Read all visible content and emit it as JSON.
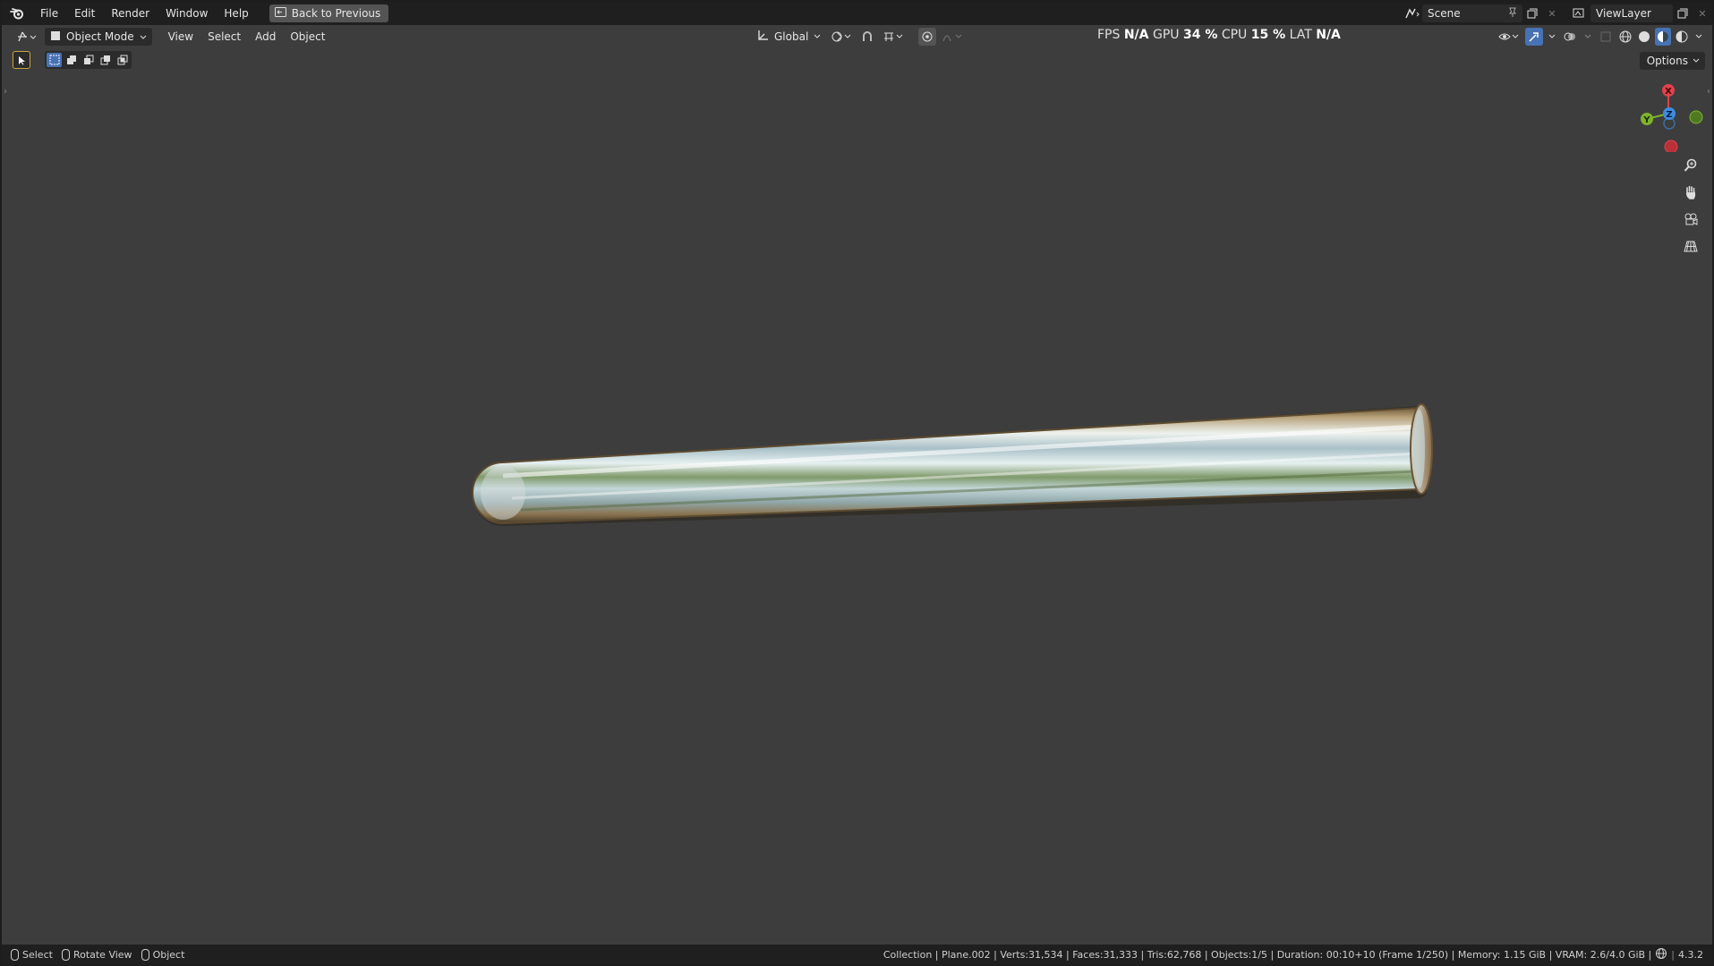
{
  "topbar": {
    "menus": [
      "File",
      "Edit",
      "Render",
      "Window",
      "Help"
    ],
    "back_label": "Back to Previous",
    "scene_label": "Scene",
    "viewlayer_label": "ViewLayer"
  },
  "header": {
    "mode_label": "Object Mode",
    "menus": [
      "View",
      "Select",
      "Add",
      "Object"
    ],
    "orientation_label": "Global",
    "options_label": "Options"
  },
  "stats": {
    "fps_label": "FPS",
    "fps_value": "N/A",
    "gpu_label": "GPU",
    "gpu_value": "34 %",
    "cpu_label": "CPU",
    "cpu_value": "15 %",
    "lat_label": "LAT",
    "lat_value": "N/A"
  },
  "gizmo": {
    "x_label": "X",
    "y_label": "Y",
    "z_label": "Z"
  },
  "statusbar": {
    "select_label": "Select",
    "rotate_label": "Rotate View",
    "object_label": "Object",
    "info": "Collection | Plane.002 | Verts:31,534 | Faces:31,333 | Tris:62,768 | Objects:1/5 | Duration: 00:10+10 (Frame 1/250) | Memory: 1.15 GiB | VRAM: 2.6/4.0 GiB |",
    "version": "4.3.2"
  },
  "colors": {
    "accent": "#4772b3",
    "axis_x": "#e2424c",
    "axis_y": "#7fb32b",
    "axis_z": "#3c8de2"
  }
}
